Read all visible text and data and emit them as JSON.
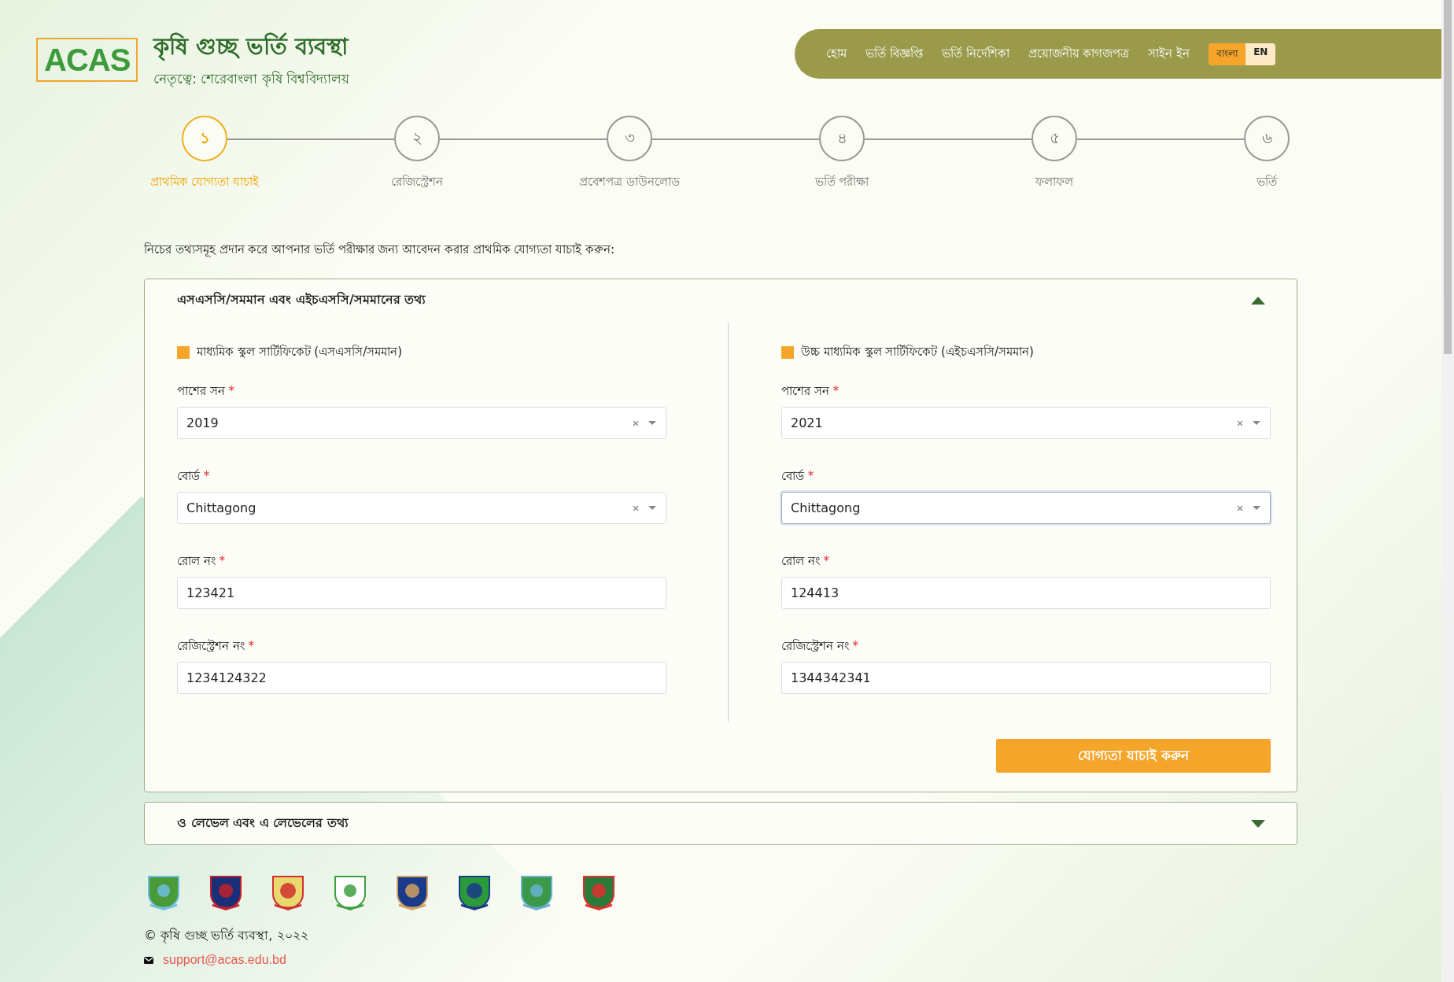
{
  "header": {
    "logo": "ACAS",
    "title": "কৃষি গুচ্ছ ভর্তি ব্যবস্থা",
    "subtitle": "নেতৃত্বে: শেরেবাংলা কৃষি বিশ্ববিদ্যালয়"
  },
  "nav": {
    "items": [
      "হোম",
      "ভর্তি বিজ্ঞপ্তি",
      "ভর্তি নির্দেশিকা",
      "প্রয়োজনীয় কাগজপত্র",
      "সাইন ইন"
    ],
    "languages": [
      {
        "label": "বাংলা",
        "selected": true
      },
      {
        "label": "EN",
        "selected": false
      }
    ]
  },
  "steps": [
    {
      "number": "১",
      "label": "প্রাথমিক যোগ্যতা যাচাই",
      "selected": true
    },
    {
      "number": "২",
      "label": "রেজিস্ট্রেশন",
      "selected": false
    },
    {
      "number": "৩",
      "label": "প্রবেশপত্র ডাউনলোড",
      "selected": false
    },
    {
      "number": "৪",
      "label": "ভর্তি পরীক্ষা",
      "selected": false
    },
    {
      "number": "৫",
      "label": "ফলাফল",
      "selected": false
    },
    {
      "number": "৬",
      "label": "ভর্তি",
      "selected": false
    }
  ],
  "intro": "নিচের তথ্যসমূহ প্রদান করে আপনার ভর্তি পরীক্ষার জন্য আবেদন করার প্রাথমিক যোগ্যতা যাচাই করুন:",
  "sections": [
    {
      "title": "এসএসসি/সমমান এবং এইচএসসি/সমমানের তথ্য",
      "expanded": true,
      "columns": [
        {
          "checkbox": {
            "label": "মাধ্যমিক স্কুল সার্টিফিকেট (এসএসসি/সমমান)",
            "checked": true
          },
          "fields": [
            {
              "kind": "select",
              "label": "পাশের সন",
              "required_mark": "*",
              "value": "2019",
              "focused": false
            },
            {
              "kind": "select",
              "label": "বোর্ড",
              "required_mark": "*",
              "value": "Chittagong",
              "focused": false
            },
            {
              "kind": "text",
              "label": "রোল নং",
              "required_mark": "*",
              "value": "123421",
              "focused": false
            },
            {
              "kind": "text",
              "label": "রেজিস্ট্রেশন নং",
              "required_mark": "*",
              "value": "1234124322",
              "focused": false
            }
          ]
        },
        {
          "checkbox": {
            "label": "উচ্চ মাধ্যমিক স্কুল সার্টিফিকেট (এইচএসসি/সমমান)",
            "checked": true
          },
          "fields": [
            {
              "kind": "select",
              "label": "পাশের সন",
              "required_mark": "*",
              "value": "2021",
              "focused": false
            },
            {
              "kind": "select",
              "label": "বোর্ড",
              "required_mark": "*",
              "value": "Chittagong",
              "focused": true
            },
            {
              "kind": "text",
              "label": "রোল নং",
              "required_mark": "*",
              "value": "124413",
              "focused": false
            },
            {
              "kind": "text",
              "label": "রেজিস্ট্রেশন নং",
              "required_mark": "*",
              "value": "1344342341",
              "focused": false
            }
          ]
        }
      ],
      "button": "যোগ্যতা যাচাই করুন"
    },
    {
      "title": "ও লেভেল এবং এ লেভেলের তথ্য",
      "expanded": false
    }
  ],
  "footer": {
    "copyright": "© কৃষি গুচ্ছ ভর্তি ব্যবস্থা, ২০২২",
    "email": "support@acas.edu.bd"
  }
}
